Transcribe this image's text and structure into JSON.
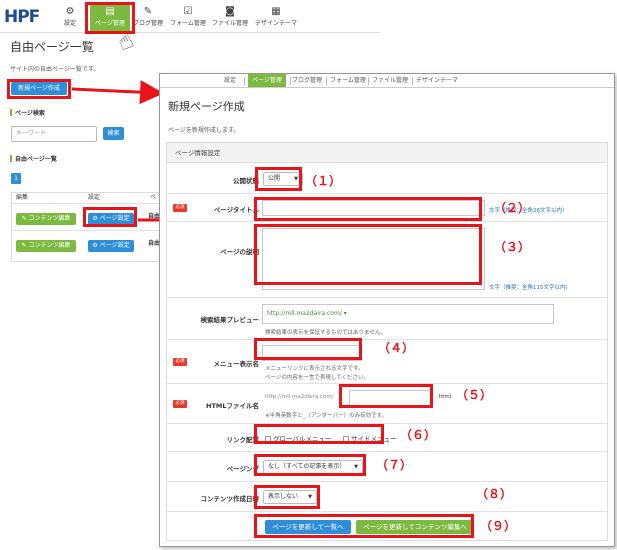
{
  "back": {
    "logo": "HPF",
    "nav": [
      {
        "label": "設定",
        "icon": "gear-icon",
        "glyph": "⚙"
      },
      {
        "label": "ページ管理",
        "icon": "page-icon",
        "glyph": "▤"
      },
      {
        "label": "ブログ管理",
        "icon": "pen-icon",
        "glyph": "✎"
      },
      {
        "label": "フォーム管理",
        "icon": "form-icon",
        "glyph": "☑"
      },
      {
        "label": "ファイル管理",
        "icon": "camera-icon",
        "glyph": "◙"
      },
      {
        "label": "デザインテーマ",
        "icon": "theme-icon",
        "glyph": "▦"
      }
    ],
    "title": "自由ページ一覧",
    "subtitle": "サイト内の自由ページ一覧です。",
    "new_button": "新規ページ作成",
    "search_heading": "ページ検索",
    "search_placeholder": "キーワード",
    "search_button": "検索",
    "list_heading": "自由ページ一覧",
    "page_number": "1",
    "col_edit": "編集",
    "col_settings": "設定",
    "col_cut": "ペ",
    "edit_button": "コンテンツ編集",
    "settings_button": "ページ設定",
    "row_cut_1": "自由",
    "row_cut_2": "自由"
  },
  "front": {
    "nav": [
      "設定",
      "ページ管理",
      "ブログ管理",
      "フォーム管理",
      "ファイル管理",
      "デザインテーマ"
    ],
    "title": "新規ページ作成",
    "subtitle": "ページを新規作成します。",
    "panel_heading": "ページ情報設定",
    "required_badge": "必須",
    "fields": {
      "status": {
        "label": "公開状態",
        "value": "公開"
      },
      "page_title": {
        "label": "ページタイトル",
        "hint": "文字（推奨：全角28文字以内）"
      },
      "description": {
        "label": "ページの説明",
        "hint": "文字（推奨：全角115文字以内）"
      },
      "preview": {
        "label": "検索結果プレビュー",
        "url": "http://mll.ma2daira.com/",
        "note": "検索結果の表示を保証するものではありません。"
      },
      "menu_name": {
        "label": "メニュー表示名",
        "note1": "メニューリンクに表示される文字です。",
        "note2": "ページの内容を一言で表現してください。"
      },
      "html_file": {
        "label": "HTMLファイル名",
        "prefix": "http://mll.ma2daira.com/",
        "suffix": ".html",
        "note": "※半角英数字と_（アンダーバー）のみ有効です。"
      },
      "link": {
        "label": "リンク配置",
        "opt1": "グローバルメニュー",
        "opt2": "サイドメニュー"
      },
      "paging": {
        "label": "ページング",
        "value": "なし（すべての記事を表示）"
      },
      "created_date": {
        "label": "コンテンツ作成日時",
        "value": "表示しない"
      }
    },
    "btn_update_list": "ページを更新して一覧へ",
    "btn_update_edit": "ページを更新してコンテンツ編集へ"
  },
  "annotations": [
    "（１）",
    "（２）",
    "（３）",
    "（４）",
    "（５）",
    "（６）",
    "（７）",
    "（８）",
    "（９）"
  ],
  "colors": {
    "accent_green": "#7cb940",
    "accent_blue": "#2e8fd8",
    "highlight_red": "#e8141a",
    "required_red": "#e8392d"
  }
}
